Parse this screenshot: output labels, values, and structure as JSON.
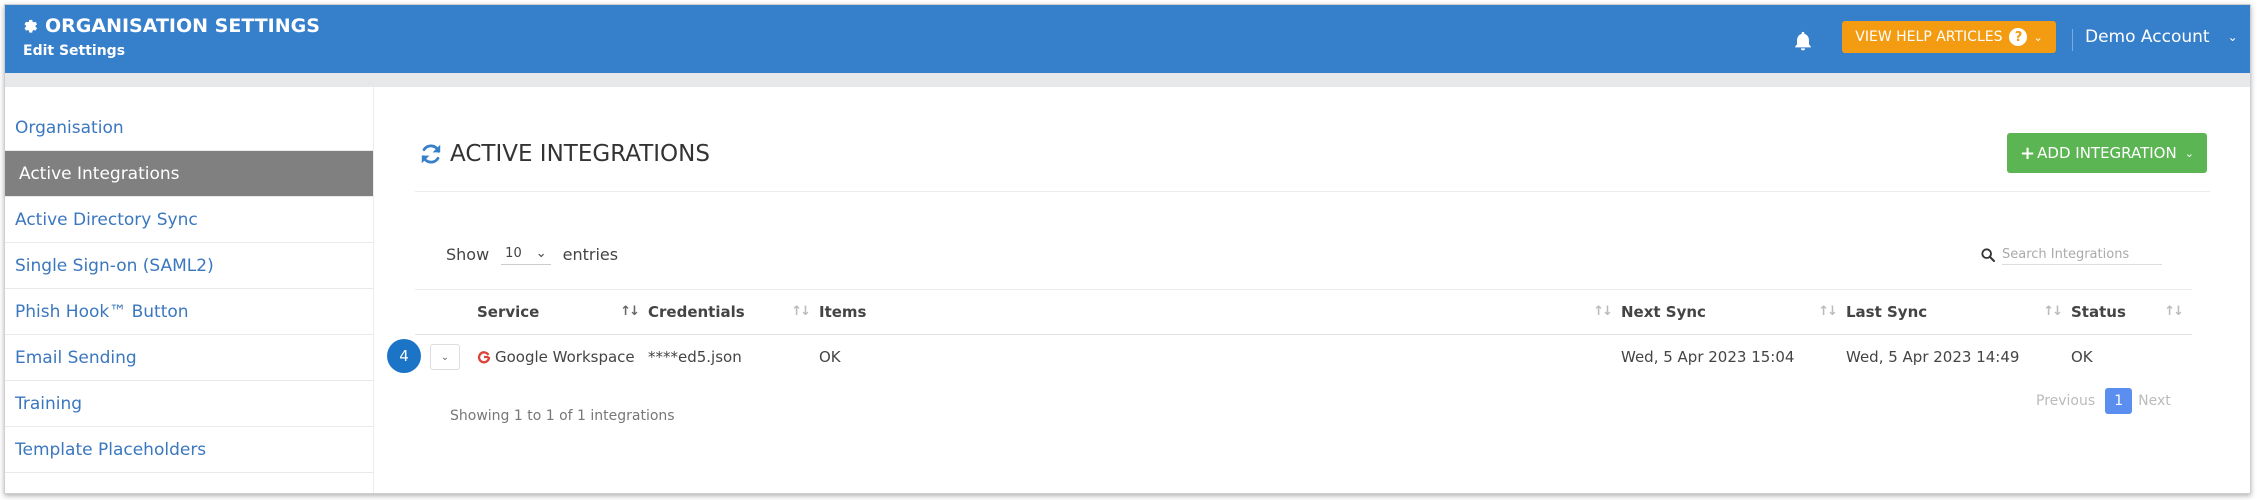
{
  "header": {
    "title": "ORGANISATION SETTINGS",
    "subtitle": "Edit Settings",
    "help_label": "VIEW HELP ARTICLES",
    "account_label": "Demo Account",
    "brand_color": "#367fcb",
    "help_color": "#f39c12"
  },
  "sidebar": {
    "items": [
      {
        "label": "Organisation",
        "active": false
      },
      {
        "label": "Active Integrations",
        "active": true
      },
      {
        "label": "Active Directory Sync",
        "active": false
      },
      {
        "label": "Single Sign-on (SAML2)",
        "active": false
      },
      {
        "label": "Phish Hook™ Button",
        "active": false
      },
      {
        "label": "Email Sending",
        "active": false
      },
      {
        "label": "Training",
        "active": false
      },
      {
        "label": "Template Placeholders",
        "active": false
      }
    ]
  },
  "main": {
    "section_title": "ACTIVE INTEGRATIONS",
    "add_button_label": "ADD INTEGRATION",
    "add_button_color": "#5bb553",
    "show_label": "Show",
    "entries_value": "10",
    "entries_label": "entries",
    "search_placeholder": "Search Integrations",
    "table": {
      "columns": [
        "Service",
        "Credentials",
        "Items",
        "Next Sync",
        "Last Sync",
        "Status"
      ],
      "rows": [
        {
          "row_number": "4",
          "service": "Google Workspace",
          "credentials": "****ed5.json",
          "items": "OK",
          "next_sync": "Wed, 5 Apr 2023 15:04",
          "last_sync": "Wed, 5 Apr 2023 14:49",
          "status": "OK"
        }
      ]
    },
    "showing_text": "Showing 1 to 1 of 1 integrations",
    "pagination": {
      "previous": "Previous",
      "current": "1",
      "next": "Next"
    }
  }
}
